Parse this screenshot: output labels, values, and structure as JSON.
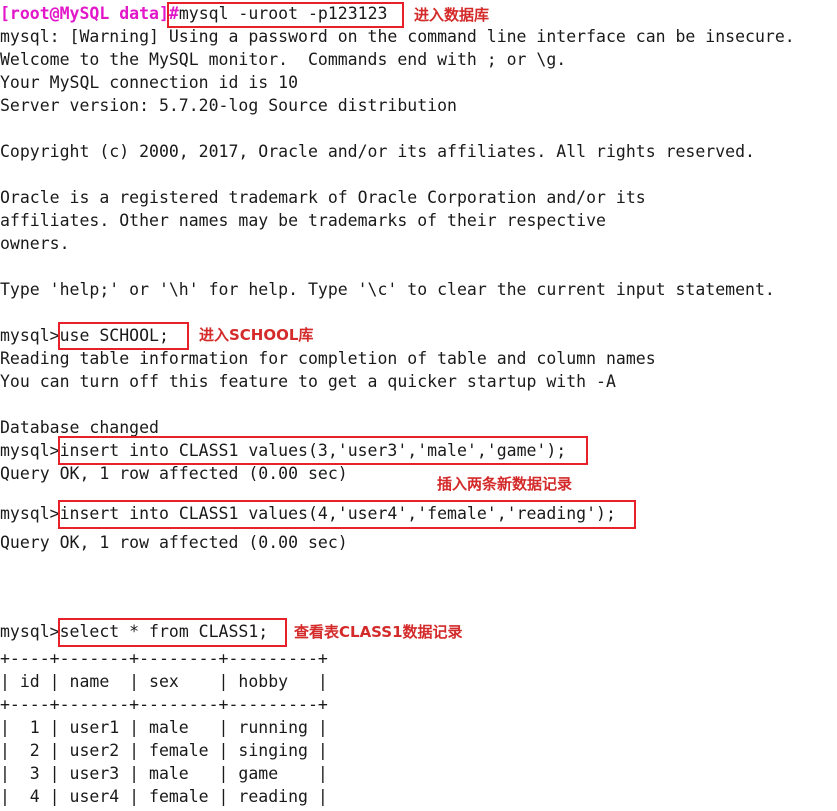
{
  "terminal": {
    "background_color": "#ffffff",
    "text_color": "#1a1a1a",
    "prompt_color": "#e217c9",
    "annotation_color": "#d42a2a",
    "box_color": "#e8202a",
    "shell_prompt": "[root@MySQL data]",
    "shell_prompt_symbol": "#",
    "mysql_prompt": "mysql>"
  },
  "lines": {
    "l01_cmd": "mysql -uroot -p123123",
    "l02": "mysql: [Warning] Using a password on the command line interface can be insecure.",
    "l03": "Welcome to the MySQL monitor.  Commands end with ; or \\g.",
    "l04": "Your MySQL connection id is 10",
    "l05": "Server version: 5.7.20-log Source distribution",
    "l06": "",
    "l07": "Copyright (c) 2000, 2017, Oracle and/or its affiliates. All rights reserved.",
    "l08": "",
    "l09": "Oracle is a registered trademark of Oracle Corporation and/or its",
    "l10": "affiliates. Other names may be trademarks of their respective",
    "l11": "owners.",
    "l12": "",
    "l13": "Type 'help;' or '\\h' for help. Type '\\c' to clear the current input statement.",
    "l14": "",
    "l15_cmd": "use SCHOOL;",
    "l16": "Reading table information for completion of table and column names",
    "l17": "You can turn off this feature to get a quicker startup with -A",
    "l18": "",
    "l19": "Database changed",
    "l20_cmd": "insert into CLASS1 values(3,'user3','male','game');",
    "l21": "Query OK, 1 row affected (0.00 sec)",
    "l22": "",
    "l23_cmd": "insert into CLASS1 values(4,'user4','female','reading');",
    "l24": "Query OK, 1 row affected (0.00 sec)",
    "l25": "",
    "l26_cmd": "select * from CLASS1;",
    "t_sep": "+----+-------+--------+---------+",
    "t_head": "| id | name  | sex    | hobby   |",
    "t_row1": "|  1 | user1 | male   | running |",
    "t_row2": "|  2 | user2 | female | singing |",
    "t_row3": "|  3 | user3 | male   | game    |",
    "t_row4": "|  4 | user4 | female | reading |"
  },
  "annotations": {
    "a1": "进入数据库",
    "a2": "进入SCHOOL库",
    "a3": "插入两条新数据记录",
    "a4": "查看表CLASS1数据记录"
  },
  "table_data": {
    "columns": [
      "id",
      "name",
      "sex",
      "hobby"
    ],
    "rows": [
      [
        "1",
        "user1",
        "male",
        "running"
      ],
      [
        "2",
        "user2",
        "female",
        "singing"
      ],
      [
        "3",
        "user3",
        "male",
        "game"
      ],
      [
        "4",
        "user4",
        "female",
        "reading"
      ]
    ]
  }
}
